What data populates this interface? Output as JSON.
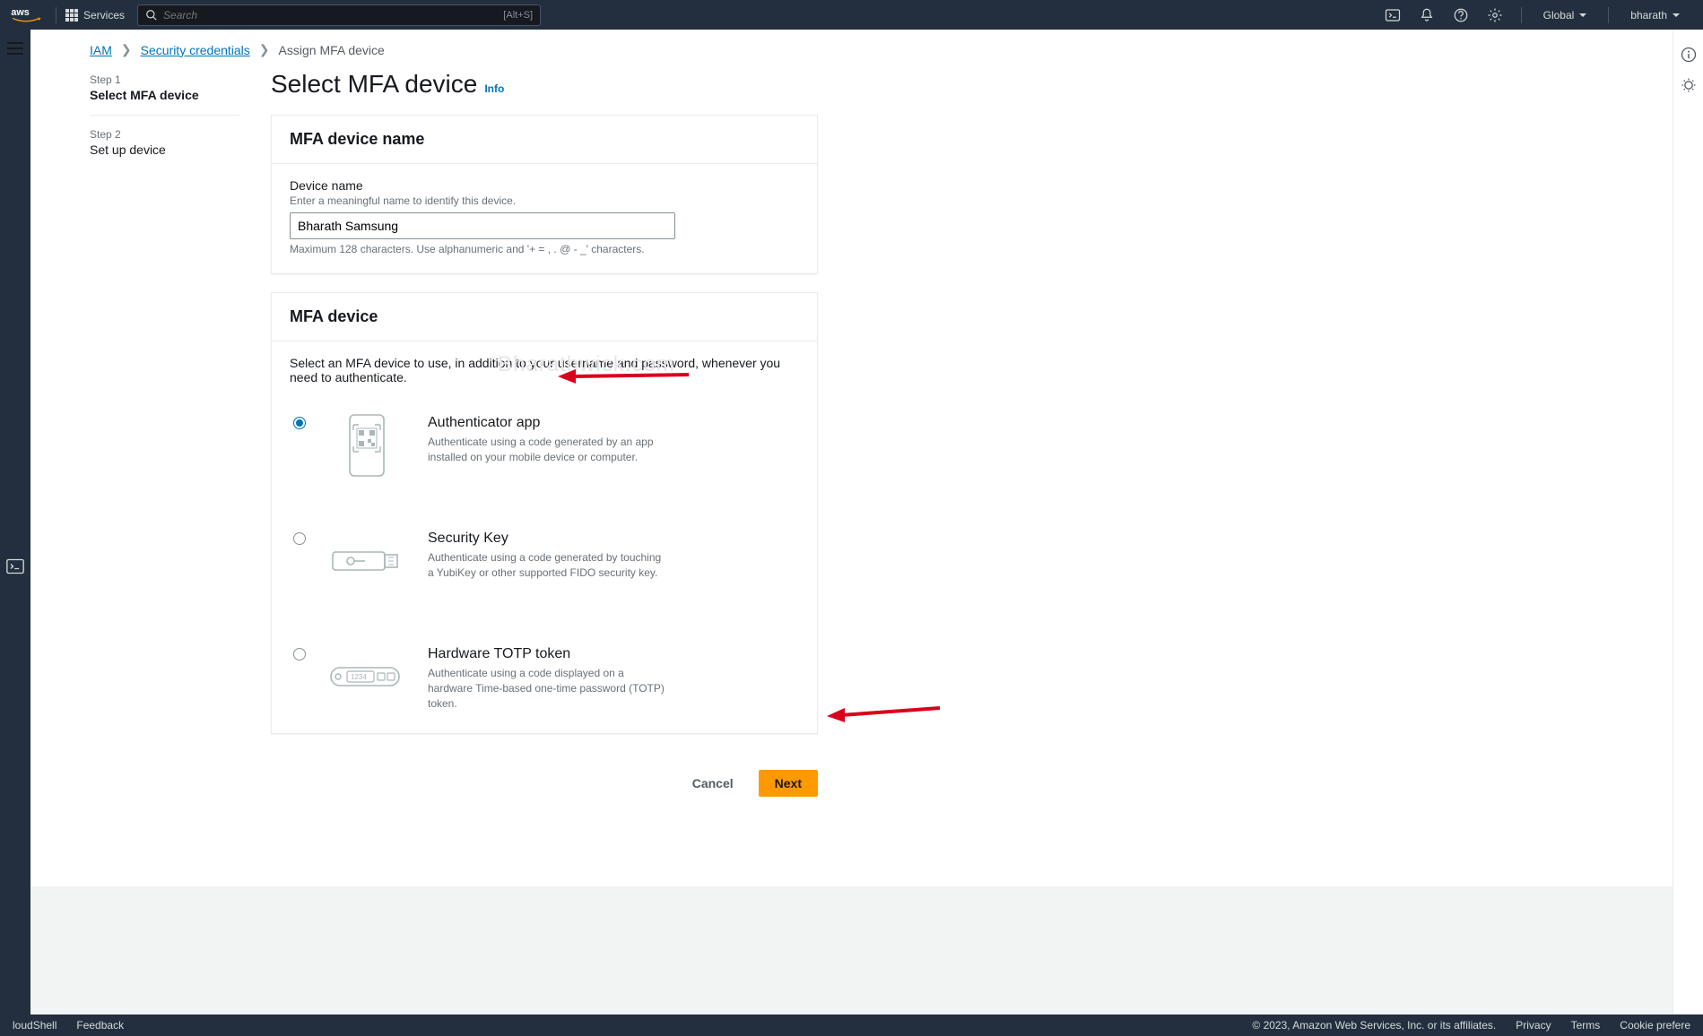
{
  "topnav": {
    "services_label": "Services",
    "search_placeholder": "Search",
    "search_kbd": "[Alt+S]",
    "region": "Global",
    "user": "bharath"
  },
  "breadcrumbs": {
    "iam": "IAM",
    "sec": "Security credentials",
    "current": "Assign MFA device"
  },
  "wizard": {
    "step1_label": "Step 1",
    "step1_title": "Select MFA device",
    "step2_label": "Step 2",
    "step2_title": "Set up device"
  },
  "page": {
    "title": "Select MFA device",
    "info": "Info"
  },
  "devicename_panel": {
    "header": "MFA device name",
    "label": "Device name",
    "hint": "Enter a meaningful name to identify this device.",
    "value": "Bharath Samsung",
    "help": "Maximum 128 characters. Use alphanumeric and '+ = , . @ - _' characters."
  },
  "mfadevice_panel": {
    "header": "MFA device",
    "intro": "Select an MFA device to use, in addition to your username and password, whenever you need to authenticate.",
    "options": [
      {
        "title": "Authenticator app",
        "desc": "Authenticate using a code generated by an app installed on your mobile device or computer."
      },
      {
        "title": "Security Key",
        "desc": "Authenticate using a code generated by touching a YubiKey or other supported FIDO security key."
      },
      {
        "title": "Hardware TOTP token",
        "desc": "Authenticate using a code displayed on a hardware Time-based one-time password (TOTP) token."
      }
    ]
  },
  "actions": {
    "cancel": "Cancel",
    "next": "Next"
  },
  "footer": {
    "cloudshell": "loudShell",
    "feedback": "Feedback",
    "copyright": "© 2023, Amazon Web Services, Inc. or its affiliates.",
    "privacy": "Privacy",
    "terms": "Terms",
    "cookie": "Cookie prefere"
  },
  "watermark": "Bharathwick.com"
}
